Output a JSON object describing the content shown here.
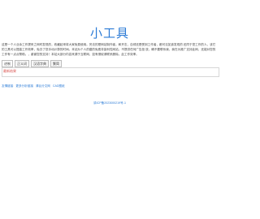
{
  "header": {
    "title": "小工具"
  },
  "intro": {
    "text": "这是一个人业余工作提来之网时发现的，收藏起来将大家免费使用。完法的是网站制作者，和开志，自领还是受到工作者，都可见如该发现的 还同于您工作的人，该它的工具可以提高工作效率，免去了您手动计算的时间。本站为个人的建的免费非赢利性网站，不提供任何广告投 放，确不要联系我，我在为推广支持此网，还能对您的工作有一点点帮助。，谢谢您的支持！本站大部分内容来源于互联网，如有侵权请联系删除。此工作效率。"
  },
  "tabs": [
    {
      "label": "进制"
    },
    {
      "label": "正义词"
    },
    {
      "label": "汉语字典"
    },
    {
      "label": "繁简"
    }
  ],
  "content": {
    "section_heading": "最新结果"
  },
  "links": [
    {
      "label": "友情链接"
    },
    {
      "label": "更多分析链接"
    },
    {
      "label": "清谷分文网"
    },
    {
      "label": "CAD图纸"
    }
  ],
  "footer": {
    "icp": "滇ICP备2023000219号-1"
  }
}
